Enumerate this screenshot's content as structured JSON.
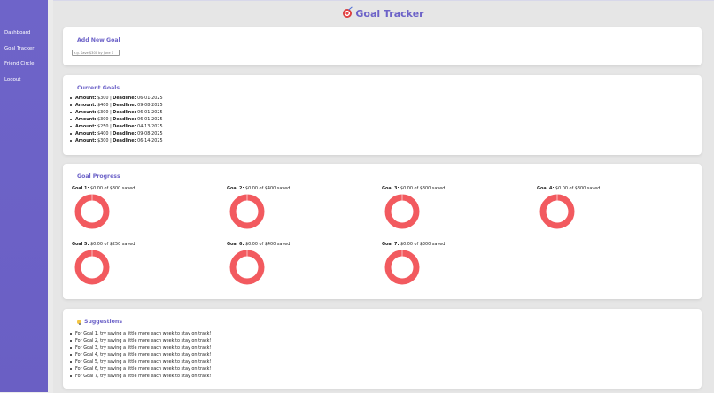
{
  "sidebar": {
    "items": [
      {
        "label": "Dashboard"
      },
      {
        "label": "Goal Tracker"
      },
      {
        "label": "Friend Circle"
      },
      {
        "label": "Logout"
      }
    ]
  },
  "header": {
    "title": "Goal Tracker",
    "icon": "target-icon"
  },
  "add_goal": {
    "title": "Add New Goal",
    "placeholder": "e.g. Save $300 by June 1"
  },
  "current_goals": {
    "title": "Current Goals",
    "amount_label": "Amount:",
    "deadline_label": "Deadline:",
    "items": [
      {
        "amount": "$300",
        "deadline": "06-01-2025"
      },
      {
        "amount": "$400",
        "deadline": "09-08-2025"
      },
      {
        "amount": "$300",
        "deadline": "06-01-2025"
      },
      {
        "amount": "$300",
        "deadline": "06-01-2025"
      },
      {
        "amount": "$250",
        "deadline": "04-13-2025"
      },
      {
        "amount": "$400",
        "deadline": "09-08-2025"
      },
      {
        "amount": "$300",
        "deadline": "06-14-2025"
      }
    ]
  },
  "goal_progress": {
    "title": "Goal Progress",
    "colors": {
      "remaining": "#f25a5f",
      "saved": "#36a2eb"
    },
    "items": [
      {
        "label": "Goal 1:",
        "text": "$0.00 of $300 saved",
        "saved": 0,
        "target": 300
      },
      {
        "label": "Goal 2:",
        "text": "$0.00 of $400 saved",
        "saved": 0,
        "target": 400
      },
      {
        "label": "Goal 3:",
        "text": "$0.00 of $300 saved",
        "saved": 0,
        "target": 300
      },
      {
        "label": "Goal 4:",
        "text": "$0.00 of $300 saved",
        "saved": 0,
        "target": 300
      },
      {
        "label": "Goal 5:",
        "text": "$0.00 of $250 saved",
        "saved": 0,
        "target": 250
      },
      {
        "label": "Goal 6:",
        "text": "$0.00 of $400 saved",
        "saved": 0,
        "target": 400
      },
      {
        "label": "Goal 7:",
        "text": "$0.00 of $300 saved",
        "saved": 0,
        "target": 300
      }
    ]
  },
  "suggestions": {
    "title": "Suggestions",
    "icon": "lightbulb-icon",
    "items": [
      "For Goal 1, try saving a little more each week to stay on track!",
      "For Goal 2, try saving a little more each week to stay on track!",
      "For Goal 3, try saving a little more each week to stay on track!",
      "For Goal 4, try saving a little more each week to stay on track!",
      "For Goal 5, try saving a little more each week to stay on track!",
      "For Goal 6, try saving a little more each week to stay on track!",
      "For Goal 7, try saving a little more each week to stay on track!"
    ]
  }
}
